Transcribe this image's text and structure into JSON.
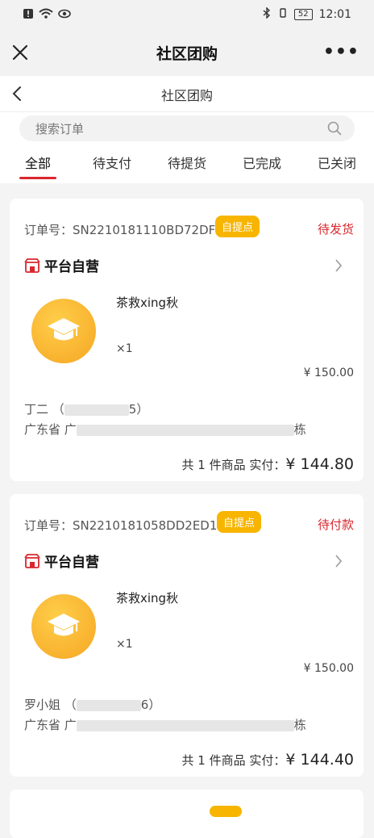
{
  "status_bar": {
    "battery": "52",
    "time": "12:01"
  },
  "topbar": {
    "title": "社区团购"
  },
  "subbar": {
    "title": "社区团购"
  },
  "search": {
    "placeholder": "搜索订单"
  },
  "tabs": [
    {
      "label": "全部"
    },
    {
      "label": "待支付"
    },
    {
      "label": "待提货"
    },
    {
      "label": "已完成"
    },
    {
      "label": "已关闭"
    }
  ],
  "orders": [
    {
      "order_no": "订单号：SN2210181110BD72DF",
      "pickup_tag": "自提点",
      "status": "待发货",
      "shop": "平台自营",
      "product": "茶救xing秋",
      "qty": "×1",
      "price": "¥ 150.00",
      "buyer_name": "丁二 （",
      "buyer_phone_tail": "5）",
      "address_start": "广东省 广",
      "address_end": "栋",
      "total_prefix": "共 1 件商品 实付：",
      "total": "¥ 144.80"
    },
    {
      "order_no": "订单号：SN2210181058DD2ED1",
      "pickup_tag": "自提点",
      "status": "待付款",
      "shop": "平台自营",
      "product": "茶救xing秋",
      "qty": "×1",
      "price": "¥ 150.00",
      "buyer_name": "罗小姐 （",
      "buyer_phone_tail": "6）",
      "address_start": "广东省 广",
      "address_end": "栋",
      "total_prefix": "共 1 件商品 实付：",
      "total": "¥ 144.40"
    }
  ]
}
